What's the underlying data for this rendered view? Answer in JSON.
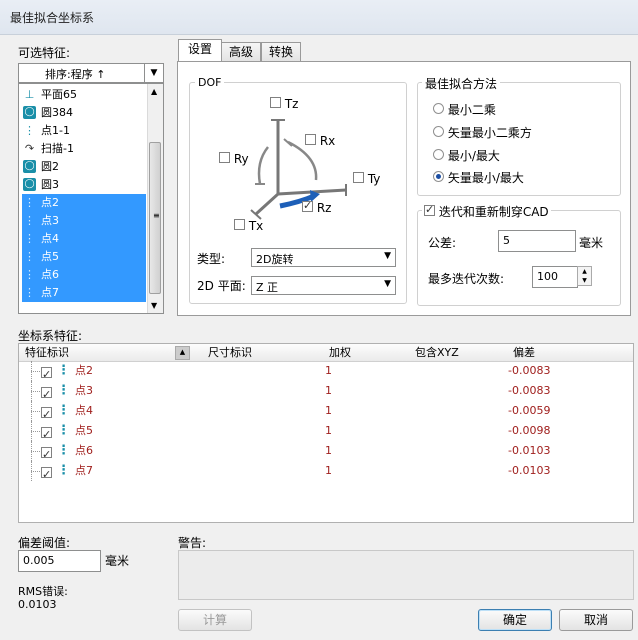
{
  "window": {
    "title": "最佳拟合坐标系"
  },
  "left_panel": {
    "label": "可选特征:",
    "sort_label": "排序:程序 ↑",
    "features": [
      {
        "name": "平面65",
        "icon": "plane-icon",
        "selected": false
      },
      {
        "name": "圆384",
        "icon": "circle-icon",
        "selected": false
      },
      {
        "name": "点1-1",
        "icon": "point-icon",
        "selected": false
      },
      {
        "name": "扫描-1",
        "icon": "scan-icon",
        "selected": false
      },
      {
        "name": "圆2",
        "icon": "circle-icon",
        "selected": false
      },
      {
        "name": "圆3",
        "icon": "circle-icon",
        "selected": false
      },
      {
        "name": "点2",
        "icon": "point-icon",
        "selected": true
      },
      {
        "name": "点3",
        "icon": "point-icon",
        "selected": true
      },
      {
        "name": "点4",
        "icon": "point-icon",
        "selected": true
      },
      {
        "name": "点5",
        "icon": "point-icon",
        "selected": true
      },
      {
        "name": "点6",
        "icon": "point-icon",
        "selected": true
      },
      {
        "name": "点7",
        "icon": "point-icon",
        "selected": true
      }
    ]
  },
  "tabs": [
    {
      "label": "设置",
      "active": true
    },
    {
      "label": "高级",
      "active": false
    },
    {
      "label": "转换",
      "active": false
    }
  ],
  "dof": {
    "label": "DOF",
    "tz": "Tz",
    "rx": "Rx",
    "ry": "Ry",
    "ty": "Ty",
    "rz": "Rz",
    "tx": "Tx",
    "type_label": "类型:",
    "type_value": "2D旋转",
    "plane_label": "2D 平面:",
    "plane_value": "Z 正"
  },
  "fit_method": {
    "label": "最佳拟合方法",
    "options": [
      "最小二乘",
      "矢量最小二乘方",
      "最小/最大",
      "矢量最小/最大"
    ],
    "selected_index": 3
  },
  "iterate": {
    "label": "迭代和重新制穿CAD",
    "tolerance_label": "公差:",
    "tolerance_value": "5",
    "tolerance_unit": "毫米",
    "max_iter_label": "最多迭代次数:",
    "max_iter_value": "100"
  },
  "coord_features": {
    "label": "坐标系特征:",
    "columns": [
      "特征标识",
      "尺寸标识",
      "加权",
      "包含XYZ",
      "偏差"
    ],
    "rows": [
      {
        "name": "点2",
        "weight": "1",
        "deviation": "-0.0083"
      },
      {
        "name": "点3",
        "weight": "1",
        "deviation": "-0.0083"
      },
      {
        "name": "点4",
        "weight": "1",
        "deviation": "-0.0059"
      },
      {
        "name": "点5",
        "weight": "1",
        "deviation": "-0.0098"
      },
      {
        "name": "点6",
        "weight": "1",
        "deviation": "-0.0103"
      },
      {
        "name": "点7",
        "weight": "1",
        "deviation": "-0.0103"
      }
    ]
  },
  "bottom": {
    "threshold_label": "偏差阈值:",
    "threshold_value": "0.005",
    "threshold_unit": "毫米",
    "rms_label": "RMS错误:",
    "rms_value": "0.0103",
    "warning_label": "警告:",
    "compute_label": "计算",
    "ok_label": "确定",
    "cancel_label": "取消"
  },
  "colors": {
    "selection": "#3399ff",
    "deviation": "#a0201e",
    "feature_icon": "#1a8fa8"
  }
}
